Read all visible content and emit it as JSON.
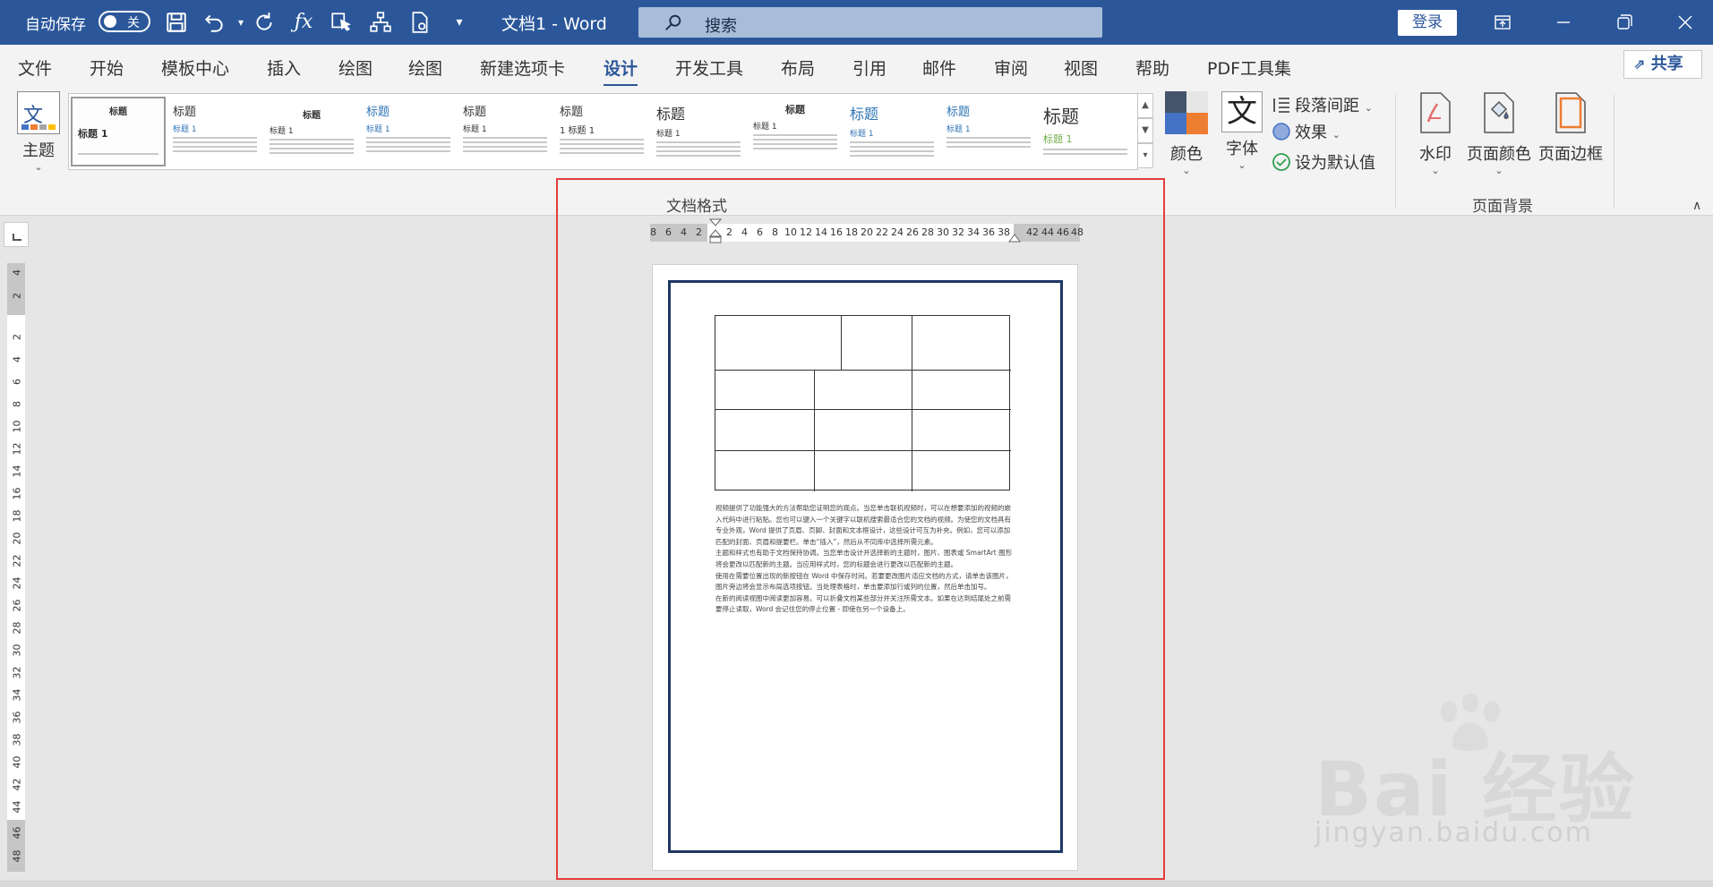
{
  "titlebar": {
    "autosave_label": "自动保存",
    "autosave_state": "关",
    "doc_title": "文档1  -  Word",
    "search_placeholder": "搜索",
    "login_label": "登录"
  },
  "tabs": [
    "文件",
    "开始",
    "模板中心",
    "插入",
    "绘图",
    "绘图",
    "新建选项卡",
    "设计",
    "开发工具",
    "布局",
    "引用",
    "邮件",
    "审阅",
    "视图",
    "帮助",
    "PDF工具集"
  ],
  "active_tab": "设计",
  "share_label": "共享",
  "ribbon": {
    "theme_label": "主题",
    "gallery": [
      {
        "title": "标题",
        "heading": "标题 1",
        "style": "center"
      },
      {
        "title": "标题",
        "heading": "标题 1",
        "style": "left"
      },
      {
        "title": "标题",
        "heading": "标题 1",
        "style": "center"
      },
      {
        "title": "标题",
        "heading": "标题 1",
        "style": "blue"
      },
      {
        "title": "标题",
        "heading": "标题 1",
        "style": "left"
      },
      {
        "title": "标题",
        "heading": "1  标题 1",
        "style": "left"
      },
      {
        "title": "标题",
        "heading": "标题 1",
        "style": "left"
      },
      {
        "title": "标题",
        "heading": "标题 1",
        "style": "center"
      },
      {
        "title": "标题",
        "heading": "标题 1",
        "style": "blue"
      },
      {
        "title": "标题",
        "heading": "标题 1",
        "style": "blue"
      },
      {
        "title": "标题",
        "heading": "标题 1",
        "style": "large"
      }
    ],
    "colors_label": "颜色",
    "fonts_label": "字体",
    "fonts_icon_char": "文",
    "paragraph_spacing_label": "段落间距",
    "effects_label": "效果",
    "set_default_label": "设为默认值",
    "group_document_format": "文档格式",
    "watermark_label": "水印",
    "page_color_label": "页面颜色",
    "page_borders_label": "页面边框",
    "group_page_background": "页面背景",
    "colors": {
      "accent": "#2b579a",
      "highlight": "#e63c3c",
      "border": "#1f3764"
    }
  },
  "hruler": [
    "8",
    "6",
    "4",
    "2",
    "2",
    "4",
    "6",
    "8",
    "10",
    "12",
    "14",
    "16",
    "18",
    "20",
    "22",
    "24",
    "26",
    "28",
    "30",
    "32",
    "34",
    "36",
    "38",
    "42",
    "44",
    "46",
    "48"
  ],
  "vruler": [
    "4",
    "2",
    "2",
    "4",
    "6",
    "8",
    "10",
    "12",
    "14",
    "16",
    "18",
    "20",
    "22",
    "24",
    "26",
    "28",
    "30",
    "32",
    "34",
    "36",
    "38",
    "40",
    "42",
    "44",
    "46",
    "48"
  ],
  "document": {
    "paragraphs": [
      "视频提供了功能强大的方法帮助您证明您的观点。当您单击联机视频时，可以在想要添加的视频的嵌入代码中进行粘贴。您也可以键入一个关键字以联机搜索最适合您的文档的视频。为使您的文档具有专业外观，Word 提供了页眉、页脚、封面和文本框设计，这些设计可互为补充。例如，您可以添加匹配的封面、页眉和提要栏。单击“插入”，然后从不同库中选择所需元素。",
      "主题和样式也有助于文档保持协调。当您单击设计并选择新的主题时，图片、图表或 SmartArt 图形将会更改以匹配新的主题。当应用样式时，您的标题会进行更改以匹配新的主题。",
      "使用在需要位置出现的新按钮在 Word 中保存时间。若要更改图片适应文档的方式，请单击该图片，图片旁边将会显示布局选项按钮。当处理表格时，单击要添加行或列的位置，然后单击加号。",
      "在新的阅读视图中阅读更加容易。可以折叠文档某些部分并关注所需文本。如果在达到结尾处之前需要停止读取，Word 会记住您的停止位置 - 即使在另一个设备上。"
    ]
  },
  "watermark": {
    "main": "Bai 经验",
    "sub": "jingyan.baidu.com"
  }
}
